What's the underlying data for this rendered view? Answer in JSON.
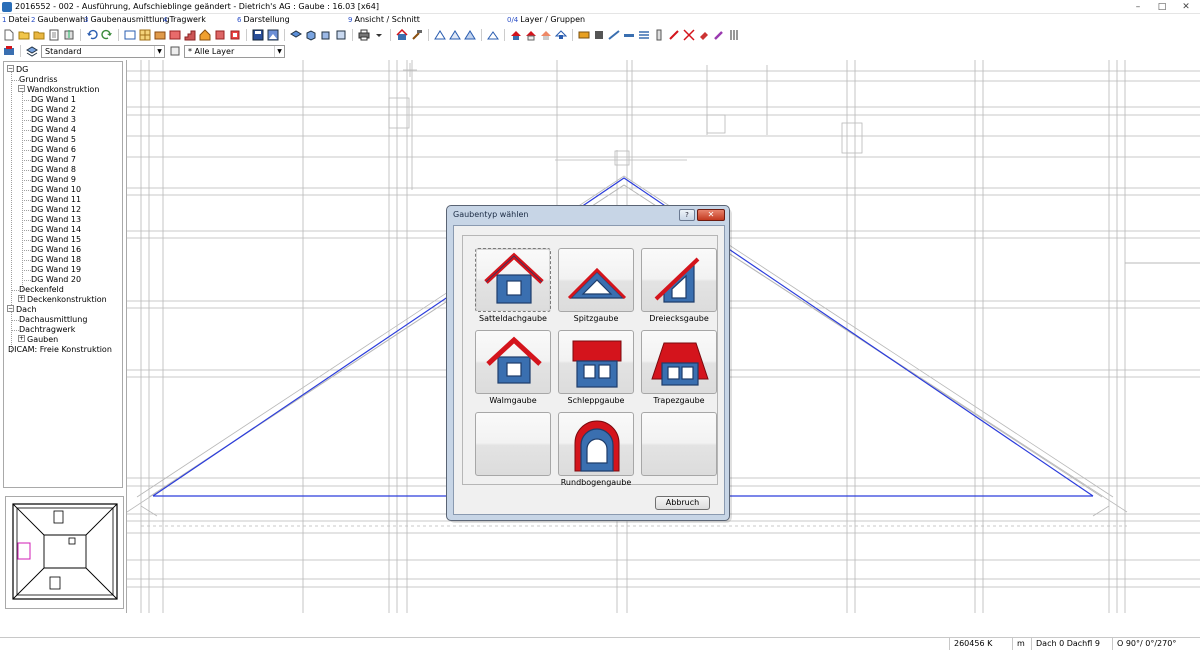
{
  "window": {
    "title": "2016552 - 002 - Ausführung, Aufschieblinge geändert - Dietrich's AG : Gaube : 16.03 [x64]",
    "minimize": "–",
    "maximize": "□",
    "close": "✕"
  },
  "menu": [
    {
      "acc": "1",
      "label": "Datei"
    },
    {
      "acc": "2",
      "label": "Gaubenwahl"
    },
    {
      "acc": "3",
      "label": "Gaubenausmittlung"
    },
    {
      "acc": "4",
      "label": "Tragwerk"
    },
    {
      "acc": "6",
      "label": "Darstellung"
    },
    {
      "acc": "9",
      "label": "Ansicht / Schnitt"
    },
    {
      "acc": "0/4",
      "label": "Layer / Gruppen"
    }
  ],
  "toolbar2": {
    "style_combo": "Standard",
    "layer_combo": "* Alle Layer"
  },
  "tree": [
    {
      "label": "DG",
      "level": 0,
      "expander": "−"
    },
    {
      "label": "Grundriss",
      "level": 1
    },
    {
      "label": "Wandkonstruktion",
      "level": 1,
      "expander": "−"
    },
    {
      "label": "DG Wand 1",
      "level": 2
    },
    {
      "label": "DG Wand 2",
      "level": 2
    },
    {
      "label": "DG Wand 3",
      "level": 2
    },
    {
      "label": "DG Wand 4",
      "level": 2
    },
    {
      "label": "DG Wand 5",
      "level": 2
    },
    {
      "label": "DG Wand 6",
      "level": 2
    },
    {
      "label": "DG Wand 7",
      "level": 2
    },
    {
      "label": "DG Wand 8",
      "level": 2
    },
    {
      "label": "DG Wand 9",
      "level": 2
    },
    {
      "label": "DG Wand 10",
      "level": 2
    },
    {
      "label": "DG Wand 11",
      "level": 2
    },
    {
      "label": "DG Wand 12",
      "level": 2
    },
    {
      "label": "DG Wand 13",
      "level": 2
    },
    {
      "label": "DG Wand 14",
      "level": 2
    },
    {
      "label": "DG Wand 15",
      "level": 2
    },
    {
      "label": "DG Wand 16",
      "level": 2
    },
    {
      "label": "DG Wand 18",
      "level": 2
    },
    {
      "label": "DG Wand 19",
      "level": 2
    },
    {
      "label": "DG Wand 20",
      "level": 2
    },
    {
      "label": "Deckenfeld",
      "level": 1
    },
    {
      "label": "Deckenkonstruktion",
      "level": 1,
      "expander": "+"
    },
    {
      "label": "Dach",
      "level": 0,
      "expander": "−"
    },
    {
      "label": "Dachausmittlung",
      "level": 1
    },
    {
      "label": "Dachtragwerk",
      "level": 1
    },
    {
      "label": "Gauben",
      "level": 1,
      "expander": "+"
    },
    {
      "label": "DICAM: Freie Konstruktion",
      "level": 0
    }
  ],
  "dialog": {
    "title": "Gaubentyp wählen",
    "help": "?",
    "close": "✕",
    "cancel": "Abbruch",
    "tiles": [
      {
        "label": "Satteldachgaube",
        "icon": "satteldach-dormer-icon",
        "selected": true
      },
      {
        "label": "Spitzgaube",
        "icon": "spitz-dormer-icon"
      },
      {
        "label": "Dreiecksgaube",
        "icon": "dreieck-dormer-icon"
      },
      {
        "label": "Walmgaube",
        "icon": "walm-dormer-icon"
      },
      {
        "label": "Schleppgaube",
        "icon": "schlepp-dormer-icon"
      },
      {
        "label": "Trapezgaube",
        "icon": "trapez-dormer-icon"
      },
      {
        "label": "",
        "icon": "empty-tile"
      },
      {
        "label": "Rundbogengaube",
        "icon": "rundbogen-dormer-icon"
      },
      {
        "label": "",
        "icon": "empty-tile"
      }
    ]
  },
  "status": {
    "count": "260456 K",
    "unit": "m",
    "roof": "Dach 0 Dachfl 9",
    "angles": "O 90°/ 0°/270°"
  },
  "colors": {
    "roof_red": "#d4141c",
    "wall_blue": "#3a6fb0",
    "wall_outline": "#1e3d6b",
    "drawing_grey": "#b8b8b8",
    "drawing_blue": "#2c3ddc",
    "dialog_frame": "#c7d5e6"
  }
}
